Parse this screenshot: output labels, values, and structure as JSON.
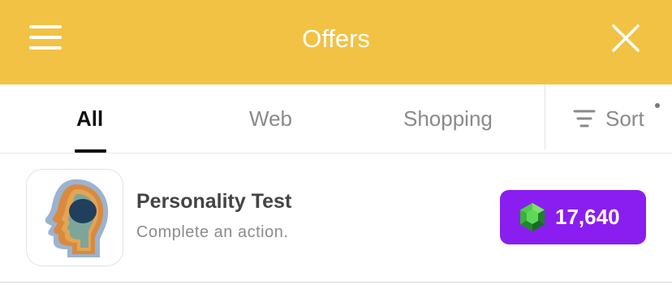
{
  "header": {
    "title": "Offers",
    "background": "#f2c244"
  },
  "tabs": [
    {
      "label": "All",
      "active": true
    },
    {
      "label": "Web",
      "active": false
    },
    {
      "label": "Shopping",
      "active": false
    }
  ],
  "sort": {
    "label": "Sort",
    "icon": "sort-lines-icon"
  },
  "offers": [
    {
      "title": "Personality Test",
      "description": "Complete an action.",
      "icon": "head-profile-icon",
      "reward": "17,640",
      "reward_icon": "gem-icon",
      "reward_color": "#8a1ef0"
    }
  ]
}
